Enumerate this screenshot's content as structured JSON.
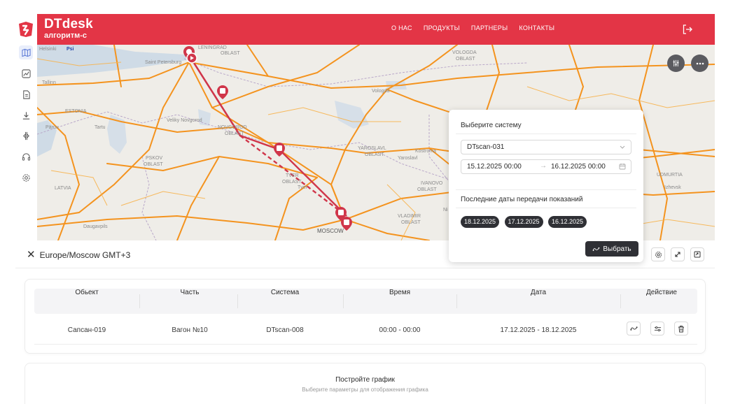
{
  "app": {
    "brand_title": "DTdesk",
    "brand_subtitle": "алгоритм-с",
    "brand_color": "#e33546"
  },
  "nav": {
    "items": [
      {
        "label": "О НАС"
      },
      {
        "label": "ПРОДУКТЫ"
      },
      {
        "label": "ПАРТНЕРЫ"
      },
      {
        "label": "КОНТАКТЫ"
      }
    ]
  },
  "sidebar": {
    "icons": [
      {
        "name": "map-icon",
        "active": true
      },
      {
        "name": "chart-icon"
      },
      {
        "name": "document-icon"
      },
      {
        "name": "download-icon"
      },
      {
        "name": "transfer-icon"
      },
      {
        "name": "headset-icon"
      },
      {
        "name": "gear-icon"
      }
    ]
  },
  "map": {
    "labels": {
      "leningrad": "LENINGRAD\nOBLAST",
      "vologda": "VOLOGDA\nOBLAST",
      "novgorod": "NOVGOROD\nOBLAST",
      "pskov": "PSKOV\nOBLAST",
      "tver": "TVER\nOBLAST",
      "yaroslavl": "YAROSLAVL\nOBLAST",
      "ivanovo": "IVANOVO\nOBLAST",
      "vladimir": "VLADIMIR\nOBLAST",
      "udmurtia": "UDMURTIA",
      "estonia": "ESTONIA",
      "latvia": "LATVIA",
      "moscow": "MOSCOW",
      "tallinn": "Tallinn",
      "tartu": "Tartu",
      "parnu": "Pärnu",
      "vologda_city": "Vologda",
      "kostroma": "Kostroma",
      "yaroslavl_city": "Yaroslavl",
      "tver_city": "Tver",
      "veliky_novgorod": "Veliky Novgorod",
      "izhevsk": "Izhevsk",
      "saint_petersburg": "Saint Petersburg",
      "daugavpils": "Daugavpils",
      "helsinki": "Helsinki",
      "psi": "Psi",
      "ni": "Ni"
    }
  },
  "timezone": "Europe/Moscow GMT+3",
  "table": {
    "headers": [
      "Обьект",
      "Часть",
      "Система",
      "Время",
      "Дата",
      "Действие"
    ],
    "rows": [
      {
        "object": "Сапсан-019",
        "part": "Вагон №10",
        "system": "DTscan-008",
        "time": "00:00 - 00:00",
        "date": "17.12.2025 - 18.12.2025"
      }
    ]
  },
  "chart_empty": {
    "title": "Постройте график",
    "subtitle": "Выберите параметры для отображения графика"
  },
  "popup": {
    "system_label": "Выберите систему",
    "system_value": "DTscan-031",
    "date_from": "15.12.2025 00:00",
    "date_to": "16.12.2025 00:00",
    "last_dates_label": "Последние даты передачи показаний",
    "last_dates": [
      "18.12.2025",
      "17.12.2025",
      "16.12.2025"
    ],
    "select_button": "Выбрать"
  }
}
